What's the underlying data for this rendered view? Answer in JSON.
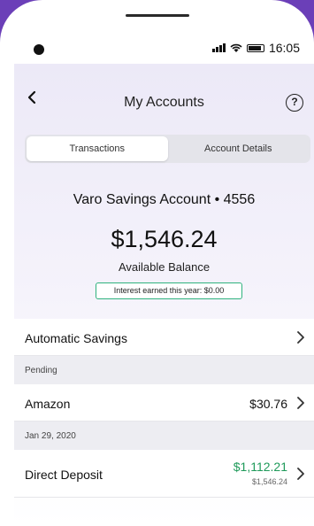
{
  "status_bar": {
    "time": "16:05"
  },
  "nav": {
    "title": "My Accounts"
  },
  "tabs": [
    {
      "label": "Transactions",
      "active": true
    },
    {
      "label": "Account Details",
      "active": false
    }
  ],
  "account": {
    "name": "Varo Savings Account • 4556",
    "balance": "$1,546.24",
    "balance_label": "Available Balance",
    "interest": "Interest earned this year: $0.00"
  },
  "list": {
    "automatic_savings": "Automatic Savings",
    "pending_header": "Pending",
    "pending_item": {
      "label": "Amazon",
      "amount": "$30.76"
    },
    "date_header": "Jan 29, 2020",
    "deposit": {
      "label": "Direct Deposit",
      "amount": "$1,112.21",
      "balance": "$1,546.24"
    }
  },
  "colors": {
    "background": "#6b3fb8",
    "accent_green": "#2fb27e",
    "deposit_green": "#1f9a5a"
  }
}
